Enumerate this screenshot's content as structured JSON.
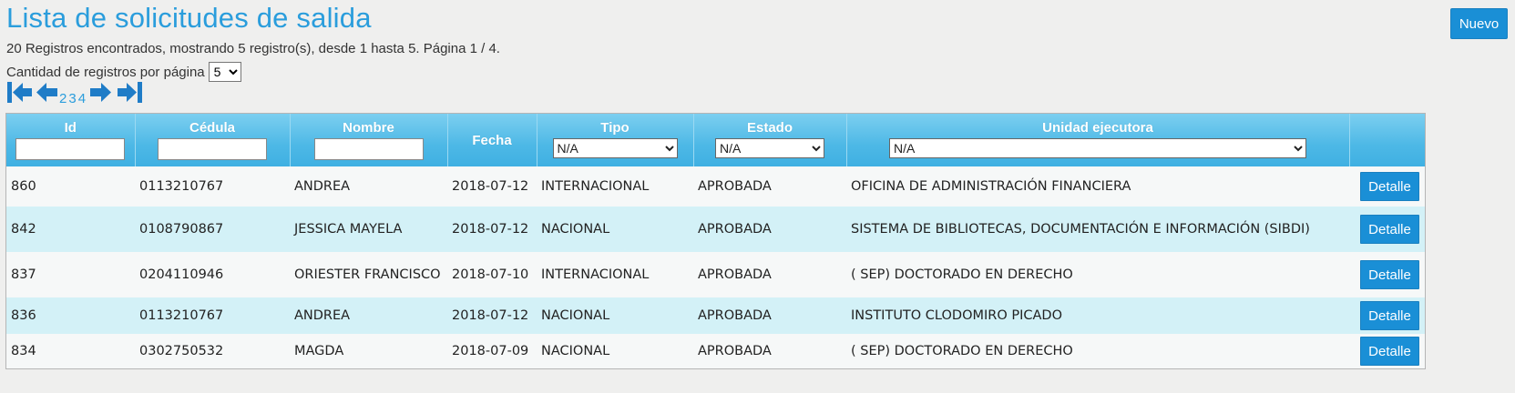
{
  "page": {
    "title": "Lista de solicitudes de salida",
    "new_label": "Nuevo",
    "summary": "20 Registros encontrados, mostrando 5 registro(s), desde 1 hasta 5. Página 1 / 4.",
    "per_page_label": "Cantidad de registros por página",
    "per_page_value": "5"
  },
  "pager": {
    "icons": [
      "first-page-icon",
      "previous-page-icon",
      "next-page-icon",
      "last-page-icon"
    ],
    "pages": [
      "2",
      "3",
      "4"
    ]
  },
  "table": {
    "headers": {
      "id": "Id",
      "cedula": "Cédula",
      "nombre": "Nombre",
      "fecha": "Fecha",
      "tipo": "Tipo",
      "estado": "Estado",
      "unidad": "Unidad ejecutora"
    },
    "filters": {
      "tipo": "N/A",
      "estado": "N/A",
      "unidad": "N/A"
    },
    "detail_label": "Detalle",
    "rows": [
      {
        "id": "860",
        "cedula": "0113210767",
        "nombre": "ANDREA",
        "fecha": "2018-07-12",
        "tipo": "INTERNACIONAL",
        "estado": "APROBADA",
        "unidad": "OFICINA DE ADMINISTRACIÓN FINANCIERA"
      },
      {
        "id": "842",
        "cedula": "0108790867",
        "nombre": "JESSICA MAYELA",
        "fecha": "2018-07-12",
        "tipo": "NACIONAL",
        "estado": "APROBADA",
        "unidad": "SISTEMA DE BIBLIOTECAS, DOCUMENTACIÓN E INFORMACIÓN (SIBDI)"
      },
      {
        "id": "837",
        "cedula": "0204110946",
        "nombre": "ORIESTER FRANCISCO",
        "fecha": "2018-07-10",
        "tipo": "INTERNACIONAL",
        "estado": "APROBADA",
        "unidad": "( SEP) DOCTORADO EN DERECHO"
      },
      {
        "id": "836",
        "cedula": "0113210767",
        "nombre": "ANDREA",
        "fecha": "2018-07-12",
        "tipo": "NACIONAL",
        "estado": "APROBADA",
        "unidad": "INSTITUTO CLODOMIRO PICADO"
      },
      {
        "id": "834",
        "cedula": "0302750532",
        "nombre": "MAGDA",
        "fecha": "2018-07-09",
        "tipo": "NACIONAL",
        "estado": "APROBADA",
        "unidad": "( SEP) DOCTORADO EN DERECHO"
      }
    ]
  },
  "colors": {
    "accent": "#2a9ddc",
    "button": "#1a8fd6",
    "header": "#4db8e6",
    "row_alt": "#d3f1f7"
  }
}
